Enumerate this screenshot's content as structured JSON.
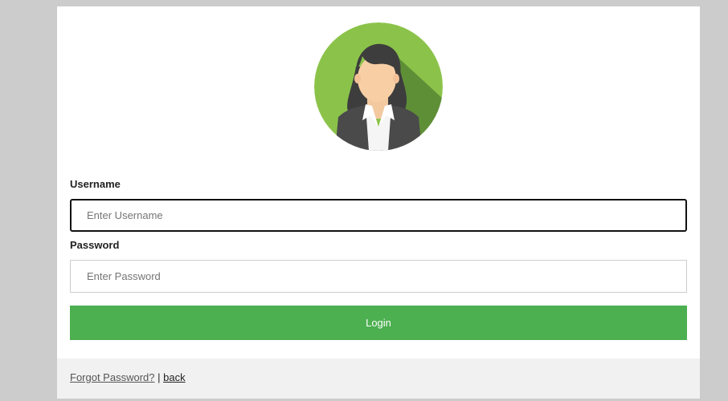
{
  "avatar": {
    "icon": "woman-avatar-icon",
    "bg_color": "#8bc34a",
    "shadow_color": "#5a8a35"
  },
  "form": {
    "username": {
      "label": "Username",
      "placeholder": "Enter Username",
      "value": ""
    },
    "password": {
      "label": "Password",
      "placeholder": "Enter Password",
      "value": ""
    },
    "login_label": "Login",
    "login_color": "#4caf50"
  },
  "footer": {
    "forgot_label": "Forgot Password?",
    "separator": "|",
    "back_label": "back"
  }
}
